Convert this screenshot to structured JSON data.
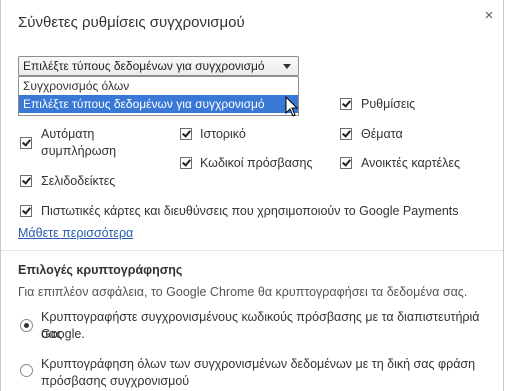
{
  "dialog": {
    "title": "Σύνθετες ρυθμίσεις συγχρονισμού",
    "close_label": "×"
  },
  "sync_select": {
    "value": "Επιλέξτε τύπους δεδομένων για συγχρονισμό",
    "options": [
      "Συγχρονισμός όλων",
      "Επιλέξτε τύπους δεδομένων για συγχρονισμό"
    ],
    "highlighted_index": 1
  },
  "checkboxes": {
    "settings": "Ρυθμίσεις",
    "autofill_line1": "Αυτόματη",
    "autofill_line2": "συμπλήρωση",
    "history": "Ιστορικό",
    "themes": "Θέματα",
    "passwords": "Κωδικοί πρόσβασης",
    "open_tabs": "Ανοικτές καρτέλες",
    "bookmarks": "Σελιδοδείκτες",
    "payments": "Πιστωτικές κάρτες και διευθύνσεις που χρησιμοποιούν το Google Payments"
  },
  "learn_more": "Μάθετε περισσότερα",
  "encryption": {
    "title": "Επιλογές κρυπτογράφησης",
    "description": "Για επιπλέον ασφάλεια, το Google Chrome θα κρυπτογραφήσει τα δεδομένα σας.",
    "option1_line1": "Κρυπτογραφήστε συγχρονισμένους κωδικούς πρόσβασης με τα διαπιστευτήριά σας",
    "option1_line2": "Google.",
    "option2_line1": "Κρυπτογράφηση όλων των συγχρονισμένων δεδομένων με τη δική σας φράση",
    "option2_line2": "πρόσβασης συγχρονισμού"
  }
}
